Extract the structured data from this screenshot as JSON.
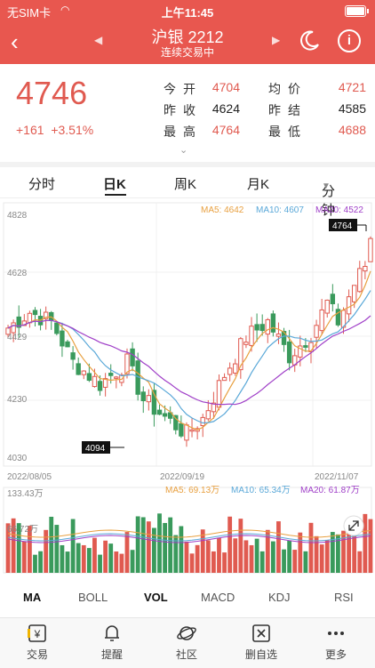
{
  "status": {
    "carrier": "无SIM卡",
    "time": "上午11:45"
  },
  "nav": {
    "title": "沪银 2212",
    "subtitle": "连续交易中"
  },
  "quote": {
    "price": "4746",
    "change": "+161",
    "change_pct": "+3.51%",
    "rows": [
      {
        "k1": "今开",
        "v1": "4704",
        "k2": "均价",
        "v2": "4721"
      },
      {
        "k1": "昨收",
        "v1": "4624",
        "k2": "昨结",
        "v2": "4585"
      },
      {
        "k1": "最高",
        "v1": "4764",
        "k2": "最低",
        "v2": "4688"
      }
    ]
  },
  "tabs": [
    "分时",
    "日K",
    "周K",
    "月K",
    "分钟"
  ],
  "kline": {
    "ma5_label": "MA5: 4642",
    "ma10_label": "MA10: 4607",
    "ma20_label": "MA20: 4522",
    "y_labels": [
      "4828",
      "4628",
      "4429",
      "4230",
      "4030"
    ],
    "x_labels": [
      "2022/08/05",
      "2022/09/19",
      "2022/11/07"
    ],
    "high_tag": "4764",
    "low_tag": "4094"
  },
  "volume": {
    "max_label": "133.43万",
    "mid_label": "66.72万",
    "ma5_label": "MA5: 69.13万",
    "ma10_label": "MA10: 65.34万",
    "ma20_label": "MA20: 61.87万"
  },
  "indicators": [
    "MA",
    "BOLL",
    "VOL",
    "MACD",
    "KDJ",
    "RSI"
  ],
  "tabbar": [
    "交易",
    "提醒",
    "社区",
    "删自选",
    "更多"
  ],
  "colors": {
    "up": "#e05a50",
    "down": "#3a9a5c",
    "ma5": "#e8a040",
    "ma10": "#5aa8d8",
    "ma20": "#a040c8",
    "header": "#e8574f"
  }
}
